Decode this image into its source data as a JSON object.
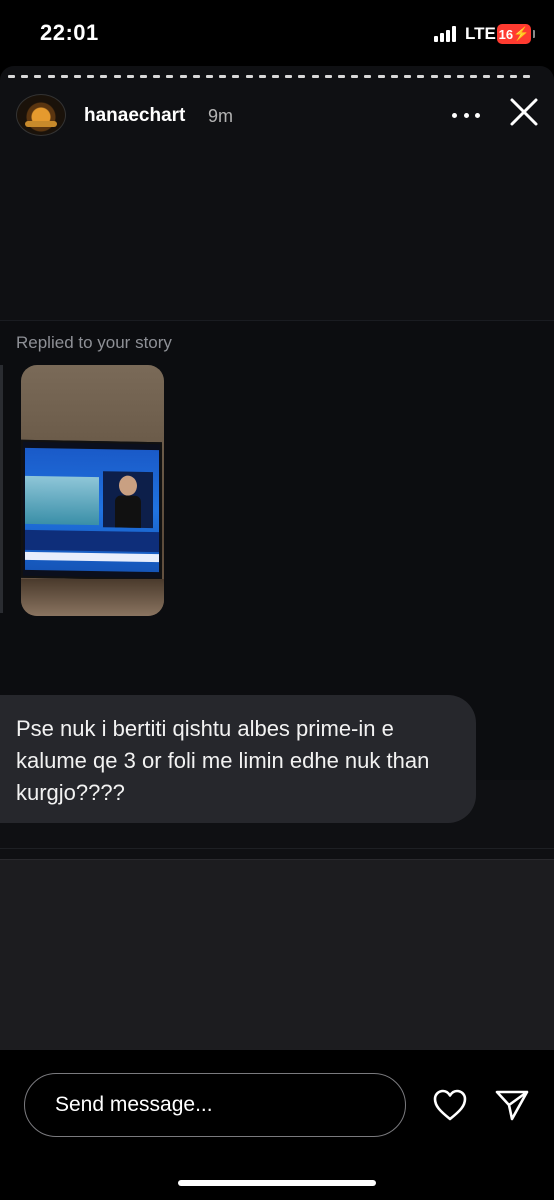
{
  "status_bar": {
    "time": "22:01",
    "network": "LTE",
    "battery": "16",
    "battery_color": "#ff3b30"
  },
  "story": {
    "username": "hanaechart",
    "time_ago": "9m",
    "more_icon": "more-horizontal-icon",
    "close_icon": "close-icon"
  },
  "thread": {
    "replied_label": "Replied to your story",
    "message": "Pse nuk i bertiti qishtu albes prime-in e kalume qe 3 or foli me limin edhe nuk than kurgjo????"
  },
  "composer": {
    "placeholder": "Send message...",
    "like_icon": "heart-icon",
    "send_icon": "send-icon"
  }
}
